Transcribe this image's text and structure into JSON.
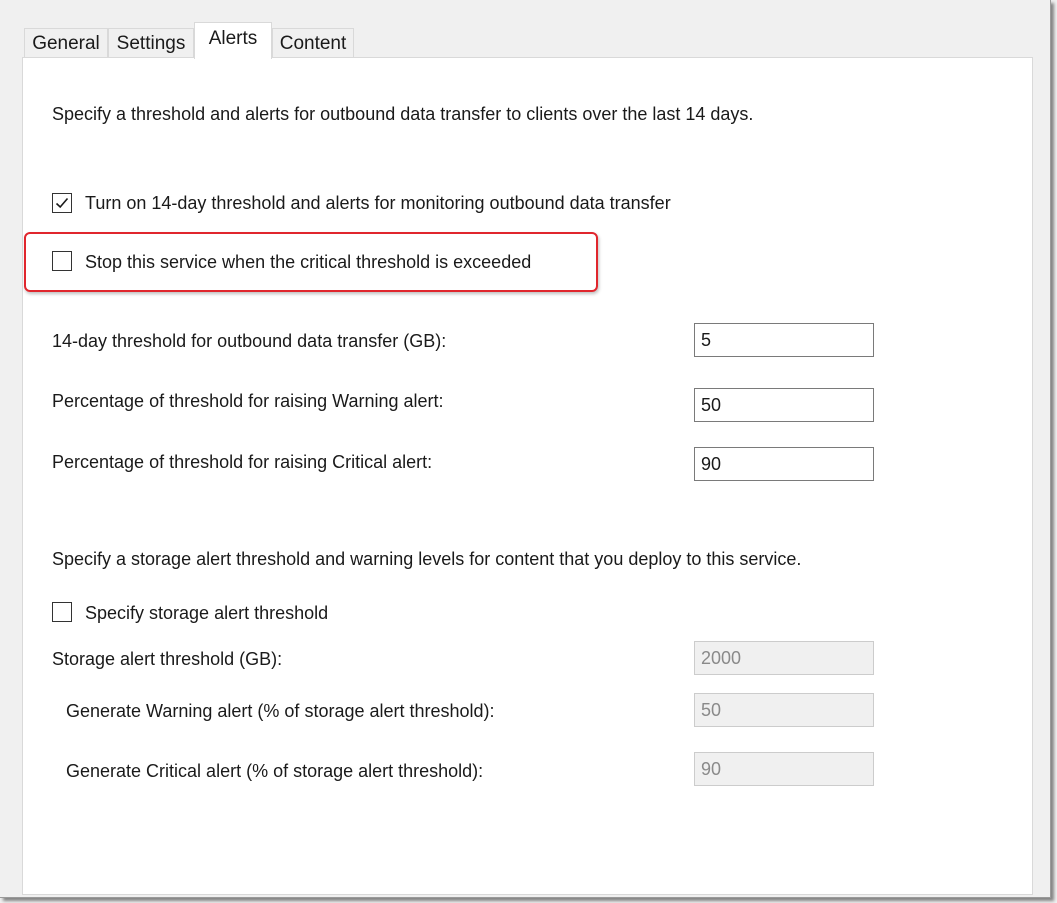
{
  "tabs": [
    {
      "label": "General",
      "active": false
    },
    {
      "label": "Settings",
      "active": false
    },
    {
      "label": "Alerts",
      "active": true
    },
    {
      "label": "Content",
      "active": false
    }
  ],
  "alerts": {
    "intro": "Specify a threshold and alerts for outbound data transfer to clients over the last 14 days.",
    "turn_on": {
      "label": "Turn on 14-day threshold and alerts for monitoring outbound data transfer",
      "checked": true
    },
    "stop_service": {
      "label": "Stop this service when the critical threshold is exceeded",
      "checked": false
    },
    "threshold": {
      "label": "14-day threshold for outbound data transfer (GB):",
      "value": "5"
    },
    "warning_pct": {
      "label": "Percentage of threshold for raising Warning alert:",
      "value": "50"
    },
    "critical_pct": {
      "label": "Percentage of threshold for raising Critical alert:",
      "value": "90"
    }
  },
  "storage": {
    "intro": "Specify a storage alert threshold and warning levels for content that you deploy to this service.",
    "specify": {
      "label": "Specify storage alert threshold",
      "checked": false
    },
    "threshold": {
      "label": "Storage alert threshold (GB):",
      "value": "2000"
    },
    "warning": {
      "label": "Generate Warning alert (% of storage alert threshold):",
      "value": "50"
    },
    "critical": {
      "label": "Generate Critical alert (% of storage alert threshold):",
      "value": "90"
    }
  },
  "colors": {
    "highlight": "#e0262d",
    "panel": "#ffffff",
    "window": "#f0f0f0"
  }
}
